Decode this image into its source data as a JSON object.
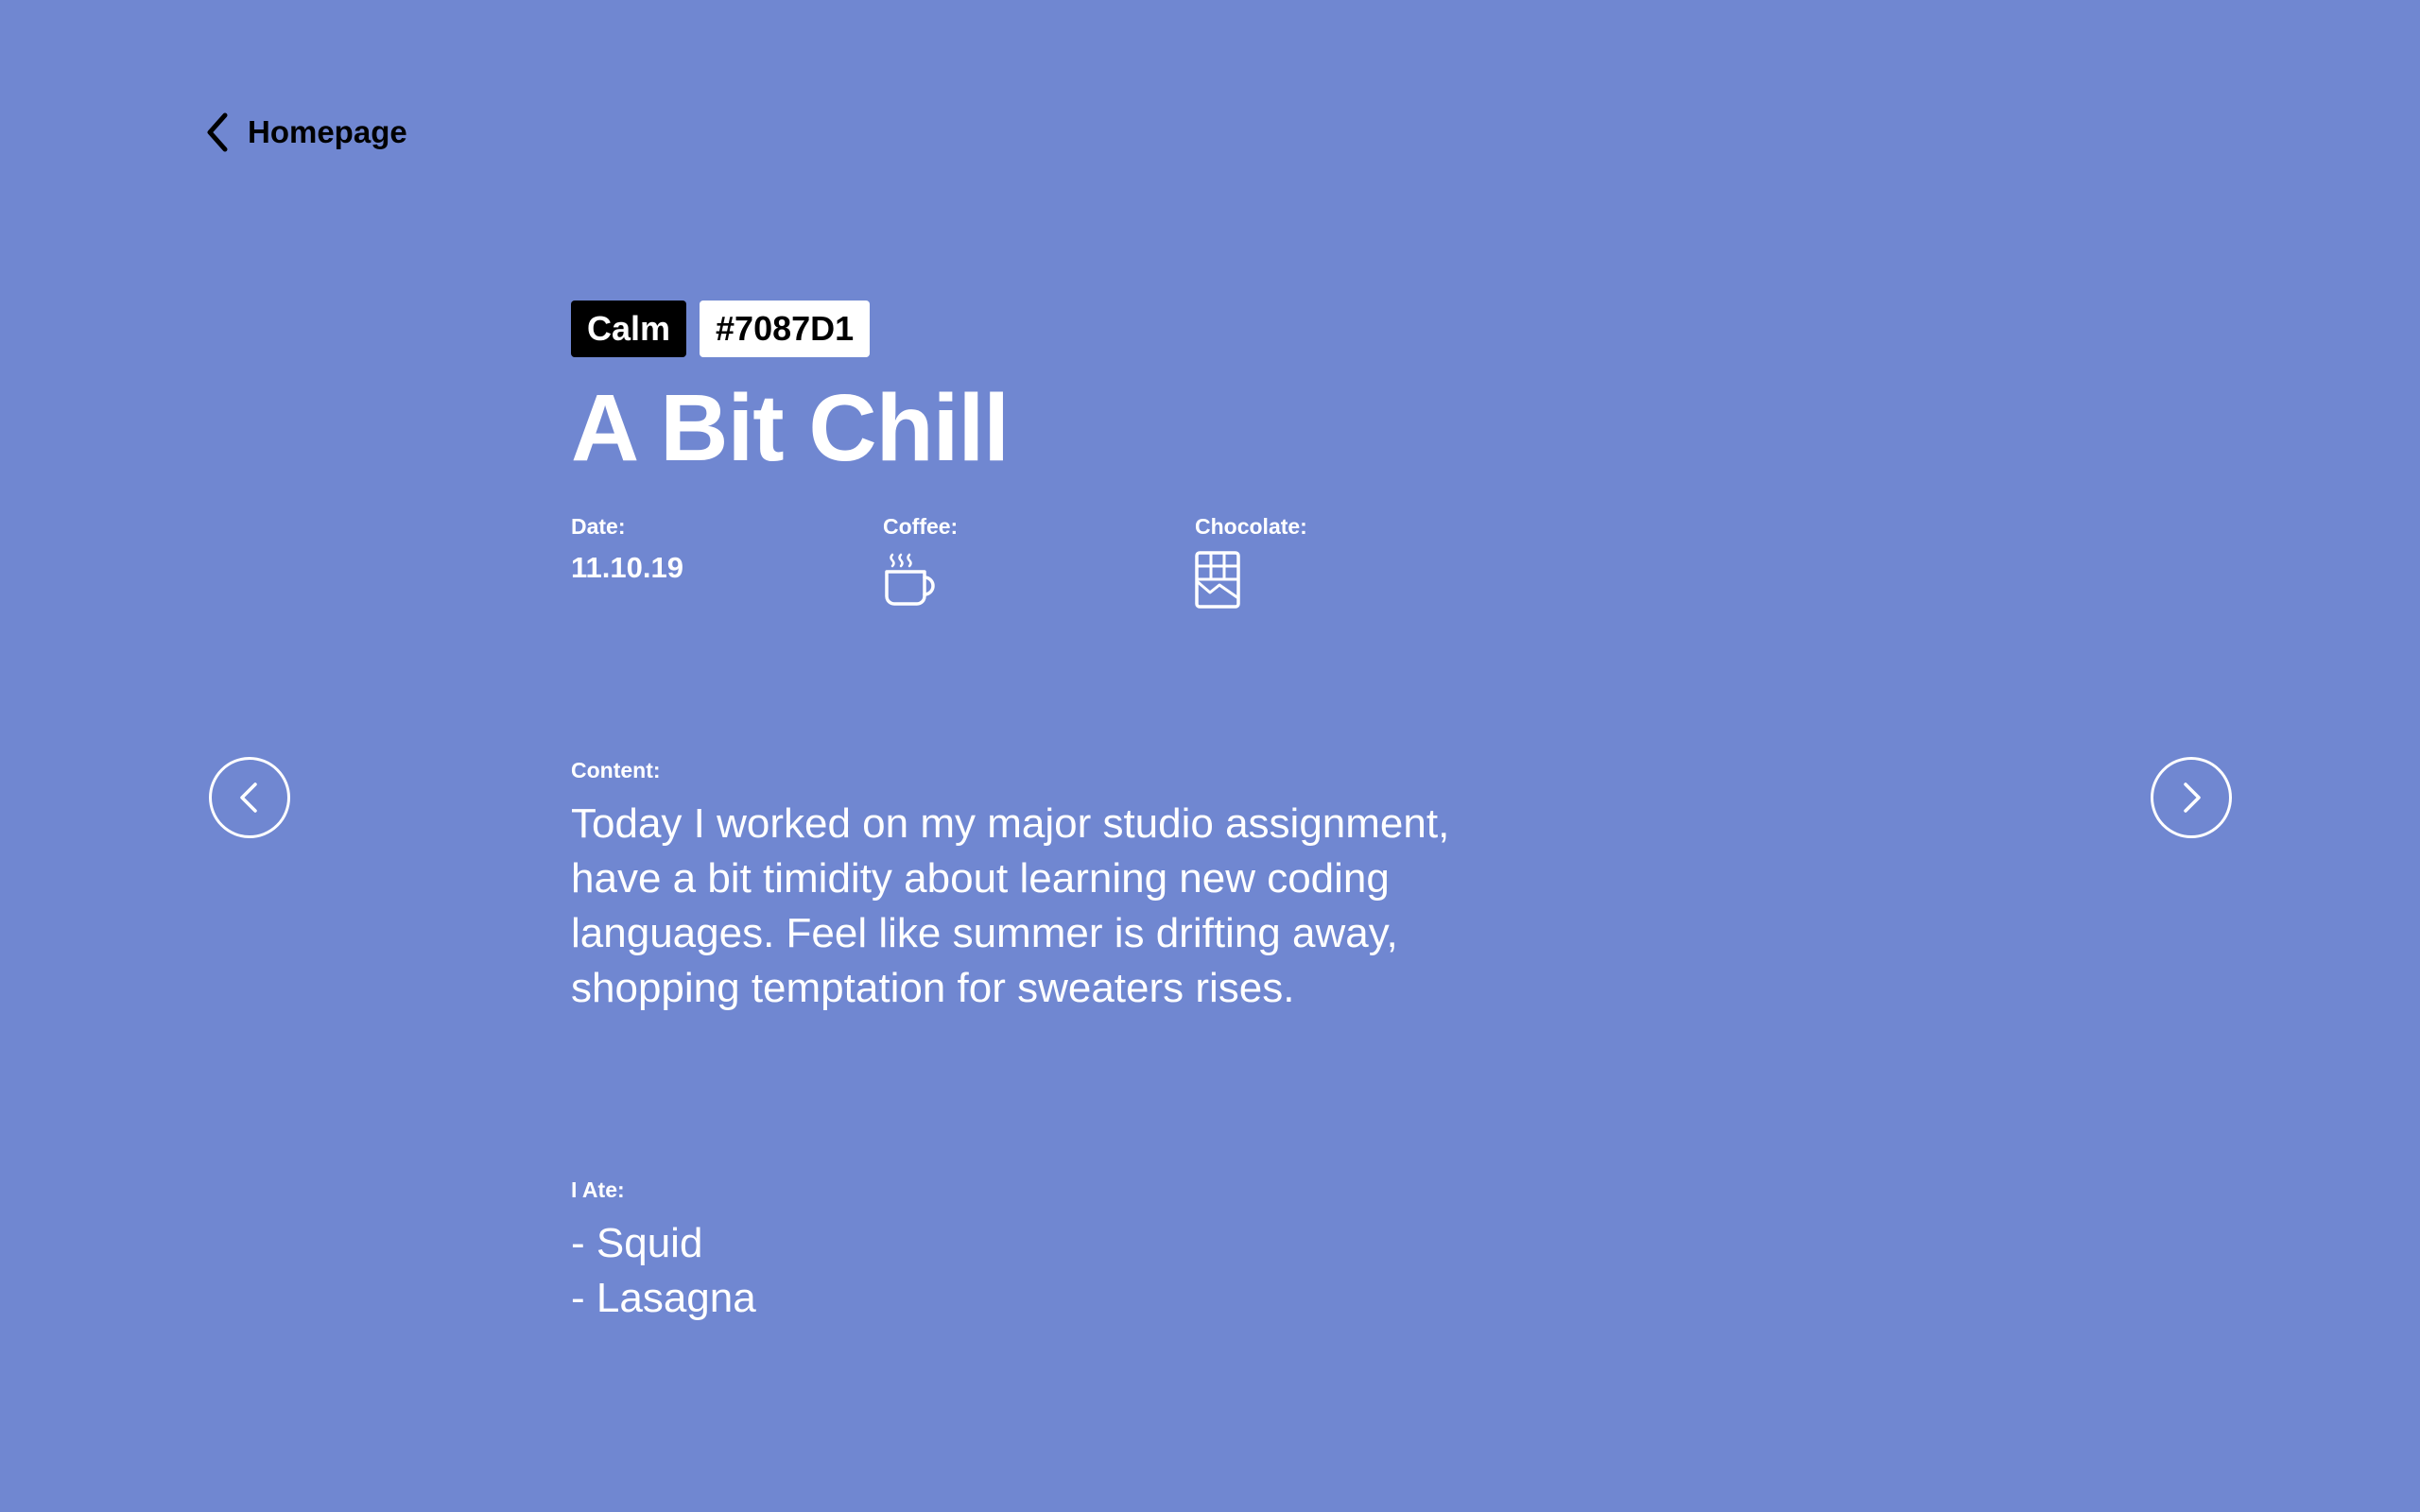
{
  "nav": {
    "back_label": "Homepage",
    "back_icon": "chevron-left-icon",
    "prev_icon": "circle-chevron-left-icon",
    "next_icon": "circle-chevron-right-icon"
  },
  "entry": {
    "mood": "Calm",
    "color_code": "#7087D1",
    "title": "A Bit Chill",
    "date_label": "Date:",
    "date": "11.10.19",
    "coffee_label": "Coffee:",
    "coffee_icon": "coffee-cup-icon",
    "chocolate_label": "Chocolate:",
    "chocolate_icon": "chocolate-bar-icon",
    "content_label": "Content:",
    "content": "Today I worked on my major studio assignment, have a bit timidity about learning new coding languages. Feel like summer is drifting away, shopping temptation for sweaters rises.",
    "ate_label": "I Ate:",
    "ate_items": [
      "- Squid",
      "- Lasagna"
    ]
  },
  "colors": {
    "background": "#7087D1",
    "tag_mood_bg": "#000000",
    "tag_color_bg": "#ffffff",
    "text": "#ffffff"
  }
}
